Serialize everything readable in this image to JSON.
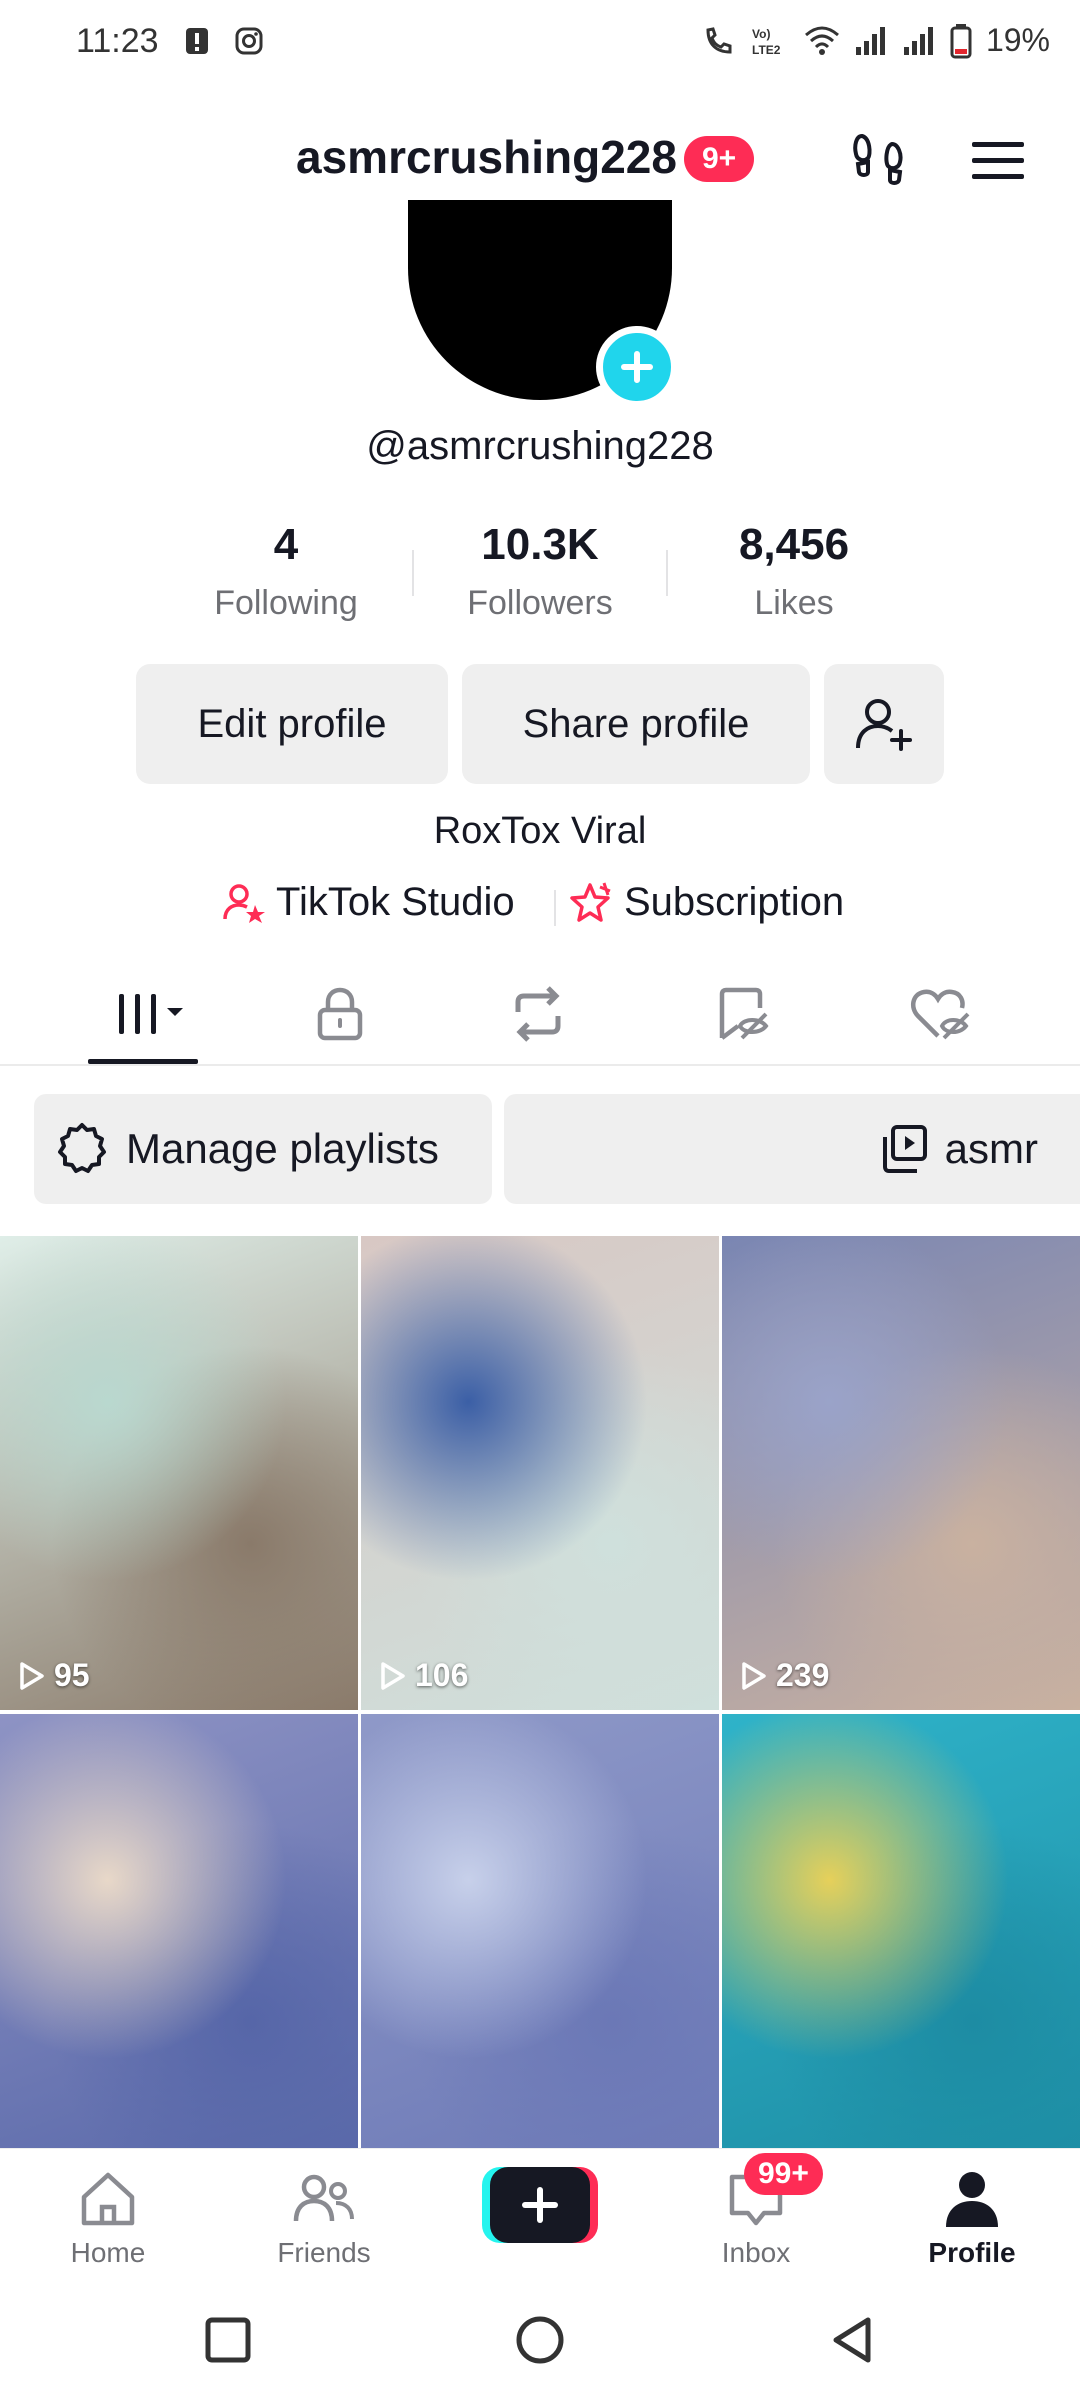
{
  "status_bar": {
    "time": "11:23",
    "battery": "19%"
  },
  "header": {
    "username": "asmrcrushing228",
    "badge": "9+"
  },
  "profile": {
    "handle": "@asmrcrushing228",
    "stats": [
      {
        "value": "4",
        "label": "Following"
      },
      {
        "value": "10.3K",
        "label": "Followers"
      },
      {
        "value": "8,456",
        "label": "Likes"
      }
    ],
    "edit_label": "Edit profile",
    "share_label": "Share profile",
    "bio": "RoxTox Viral",
    "studio_label": "TikTok Studio",
    "subscription_label": "Subscription"
  },
  "playlists": {
    "manage_label": "Manage playlists",
    "playlist_name": "asmr"
  },
  "videos": [
    {
      "views": "95",
      "colors": [
        "#dfeee8",
        "#b9d8cf",
        "#8a7a6a"
      ]
    },
    {
      "views": "106",
      "colors": [
        "#d8c8c4",
        "#3b5fa6",
        "#cfe0dc"
      ]
    },
    {
      "views": "239",
      "colors": [
        "#7a86b3",
        "#9aa3c9",
        "#c9b1a0"
      ]
    },
    {
      "views": "",
      "colors": [
        "#8e93c4",
        "#e8d8c8",
        "#5666a8"
      ]
    },
    {
      "views": "",
      "colors": [
        "#8f99c8",
        "#c7d0ea",
        "#6b78b6"
      ]
    },
    {
      "views": "",
      "colors": [
        "#2fb3c9",
        "#e6d05a",
        "#1d8ca3"
      ]
    }
  ],
  "bottom_nav": {
    "home": "Home",
    "friends": "Friends",
    "inbox": "Inbox",
    "inbox_badge": "99+",
    "profile": "Profile"
  },
  "colors": {
    "accent": "#fe2c55",
    "cyan": "#20d5ec"
  }
}
